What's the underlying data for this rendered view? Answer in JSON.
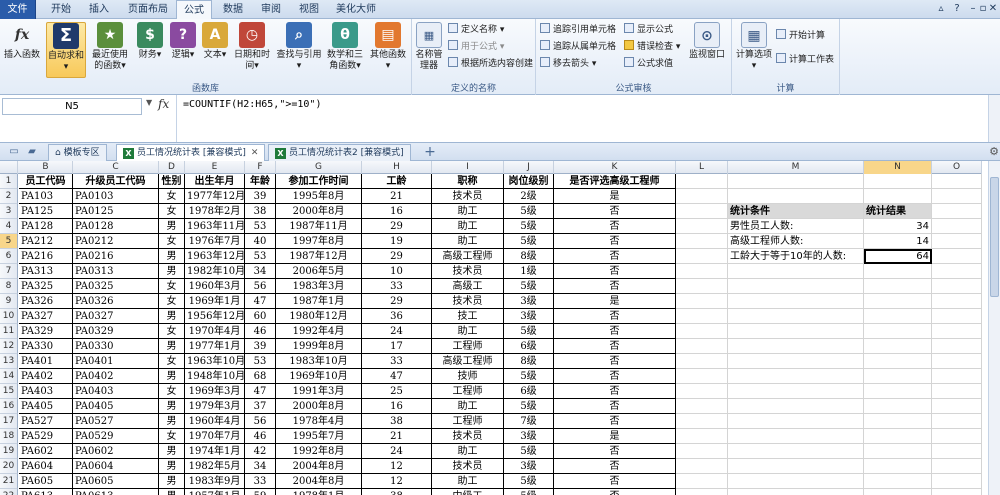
{
  "ribbon_tabs": [
    "文件",
    "开始",
    "插入",
    "页面布局",
    "公式",
    "数据",
    "审阅",
    "视图",
    "美化大师"
  ],
  "active_tab": "公式",
  "groups": {
    "library": {
      "label": "函数库",
      "buttons": [
        "插入函数",
        "自动求和",
        "最近使用的函数",
        "财务",
        "逻辑",
        "文本",
        "日期和时间",
        "查找与引用",
        "数学和三角函数",
        "其他函数"
      ]
    },
    "names": {
      "label": "定义的名称",
      "big": "名称管理器",
      "small": [
        "定义名称",
        "用于公式",
        "根据所选内容创建"
      ]
    },
    "audit": {
      "label": "公式审核",
      "small": [
        "追踪引用单元格",
        "追踪从属单元格",
        "移去箭头",
        "显示公式",
        "错误检查",
        "公式求值"
      ],
      "big": "监视窗口"
    },
    "calc": {
      "label": "计算",
      "big": "计算选项",
      "small": [
        "开始计算",
        "计算工作表"
      ]
    }
  },
  "formula_bar": {
    "cell_ref": "N5",
    "fx": "fx",
    "formula": "=COUNTIF(H2:H65,\">=10\")"
  },
  "workbook_tabs": [
    {
      "label": "模板专区",
      "active": false
    },
    {
      "label": "员工情况统计表 [兼容模式]",
      "active": true
    },
    {
      "label": "员工情况统计表2 [兼容模式]",
      "active": false
    }
  ],
  "columns": [
    "B",
    "C",
    "D",
    "E",
    "F",
    "G",
    "H",
    "I",
    "J",
    "K",
    "L",
    "M",
    "N",
    "O"
  ],
  "selected_column": "N",
  "selected_row": "5",
  "table_headers": [
    "员工代码",
    "升级员工代码",
    "性别",
    "出生年月",
    "年龄",
    "参加工作时间",
    "工龄",
    "职称",
    "岗位级别",
    "是否评选高级工程师"
  ],
  "rows": [
    [
      "PA103",
      "PA0103",
      "女",
      "1977年12月",
      "39",
      "1995年8月",
      "21",
      "技术员",
      "2级",
      "是"
    ],
    [
      "PA125",
      "PA0125",
      "女",
      "1978年2月",
      "38",
      "2000年8月",
      "16",
      "助工",
      "5级",
      "否"
    ],
    [
      "PA128",
      "PA0128",
      "男",
      "1963年11月",
      "53",
      "1987年11月",
      "29",
      "助工",
      "5级",
      "否"
    ],
    [
      "PA212",
      "PA0212",
      "女",
      "1976年7月",
      "40",
      "1997年8月",
      "19",
      "助工",
      "5级",
      "否"
    ],
    [
      "PA216",
      "PA0216",
      "男",
      "1963年12月",
      "53",
      "1987年12月",
      "29",
      "高级工程师",
      "8级",
      "否"
    ],
    [
      "PA313",
      "PA0313",
      "男",
      "1982年10月",
      "34",
      "2006年5月",
      "10",
      "技术员",
      "1级",
      "否"
    ],
    [
      "PA325",
      "PA0325",
      "女",
      "1960年3月",
      "56",
      "1983年3月",
      "33",
      "高级工",
      "5级",
      "否"
    ],
    [
      "PA326",
      "PA0326",
      "女",
      "1969年1月",
      "47",
      "1987年1月",
      "29",
      "技术员",
      "3级",
      "是"
    ],
    [
      "PA327",
      "PA0327",
      "男",
      "1956年12月",
      "60",
      "1980年12月",
      "36",
      "技工",
      "3级",
      "否"
    ],
    [
      "PA329",
      "PA0329",
      "女",
      "1970年4月",
      "46",
      "1992年4月",
      "24",
      "助工",
      "5级",
      "否"
    ],
    [
      "PA330",
      "PA0330",
      "男",
      "1977年1月",
      "39",
      "1999年8月",
      "17",
      "工程师",
      "6级",
      "否"
    ],
    [
      "PA401",
      "PA0401",
      "女",
      "1963年10月",
      "53",
      "1983年10月",
      "33",
      "高级工程师",
      "8级",
      "否"
    ],
    [
      "PA402",
      "PA0402",
      "男",
      "1948年10月",
      "68",
      "1969年10月",
      "47",
      "技师",
      "5级",
      "否"
    ],
    [
      "PA403",
      "PA0403",
      "女",
      "1969年3月",
      "47",
      "1991年3月",
      "25",
      "工程师",
      "6级",
      "否"
    ],
    [
      "PA405",
      "PA0405",
      "男",
      "1979年3月",
      "37",
      "2000年8月",
      "16",
      "助工",
      "5级",
      "否"
    ],
    [
      "PA527",
      "PA0527",
      "男",
      "1960年4月",
      "56",
      "1978年4月",
      "38",
      "工程师",
      "7级",
      "否"
    ],
    [
      "PA529",
      "PA0529",
      "女",
      "1970年7月",
      "46",
      "1995年7月",
      "21",
      "技术员",
      "3级",
      "是"
    ],
    [
      "PA602",
      "PA0602",
      "男",
      "1974年1月",
      "42",
      "1992年8月",
      "24",
      "助工",
      "5级",
      "否"
    ],
    [
      "PA604",
      "PA0604",
      "男",
      "1982年5月",
      "34",
      "2004年8月",
      "12",
      "技术员",
      "3级",
      "否"
    ],
    [
      "PA605",
      "PA0605",
      "男",
      "1983年9月",
      "33",
      "2004年8月",
      "12",
      "助工",
      "5级",
      "否"
    ],
    [
      "PA613",
      "PA0613",
      "男",
      "1957年1月",
      "59",
      "1978年1月",
      "38",
      "中级工",
      "5级",
      "否"
    ]
  ],
  "stats": {
    "header_label": "统计条件",
    "header_result": "统计结果",
    "items": [
      {
        "label": "男性员工人数:",
        "value": "34"
      },
      {
        "label": "高级工程师人数:",
        "value": "14"
      },
      {
        "label": "工龄大于等于10年的人数:",
        "value": "64"
      }
    ]
  },
  "colors": {
    "file_tab": "#2a5caa",
    "selection_header": "#f8d68a",
    "stats_header": "#d9d9d9"
  }
}
